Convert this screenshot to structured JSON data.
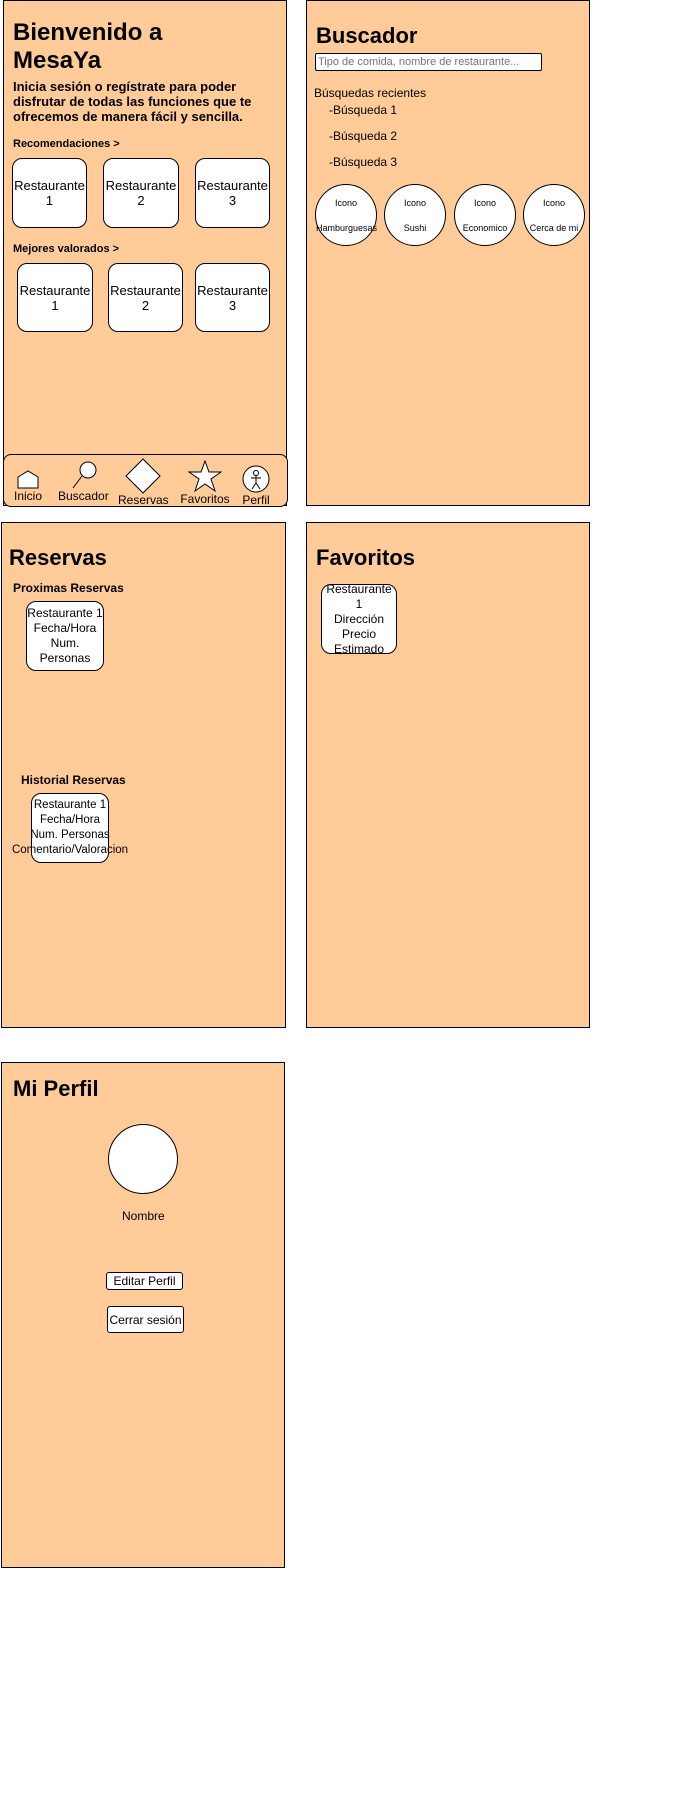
{
  "home": {
    "title": "Bienvenido a MesaYa",
    "subtitle": "Inicia sesión o regístrate para poder disfrutar de todas las funciones que te ofrecemos de manera fácil y sencilla.",
    "recommendations_label": "Recomendaciones >",
    "recommendations": [
      "Restaurante 1",
      "Restaurante 2",
      "Restaurante 3"
    ],
    "top_rated_label": "Mejores valorados >",
    "top_rated": [
      "Restaurante 1",
      "Restaurante 2",
      "Restaurante 3"
    ],
    "nav": {
      "home": "Inicio",
      "search": "Buscador",
      "bookings": "Reservas",
      "favorites": "Favoritos",
      "profile": "Perfil"
    }
  },
  "search": {
    "title": "Buscador",
    "placeholder": "Tipo de comida, nombre de restaurante...",
    "recent_label": "Búsquedas recientes",
    "recent": [
      "-Búsqueda 1",
      "-Búsqueda 2",
      "-Búsqueda 3"
    ],
    "categories": [
      {
        "icon": "Icono",
        "label": "Hamburguesas"
      },
      {
        "icon": "Icono",
        "label": "Sushi"
      },
      {
        "icon": "Icono",
        "label": "Economico"
      },
      {
        "icon": "Icono",
        "label": "Cerca de mi"
      }
    ]
  },
  "bookings": {
    "title": "Reservas",
    "upcoming_label": "Proximas Reservas",
    "upcoming_card": "Restaurante 1\nFecha/Hora\nNum. Personas",
    "history_label": "Historial Reservas",
    "history_card": "Restaurante 1\nFecha/Hora\nNum. Personas\nComentario/Valoracion"
  },
  "favorites": {
    "title": "Favoritos",
    "card": "Restaurante 1\nDirección\nPrecio\nEstimado"
  },
  "profile": {
    "title": "Mi Perfil",
    "name": "Nombre",
    "edit_button": "Editar Perfil",
    "logout_button": "Cerrar sesión"
  },
  "colors": {
    "panel_bg": "#ffcc99",
    "border": "#000000",
    "card_bg": "#ffffff"
  }
}
